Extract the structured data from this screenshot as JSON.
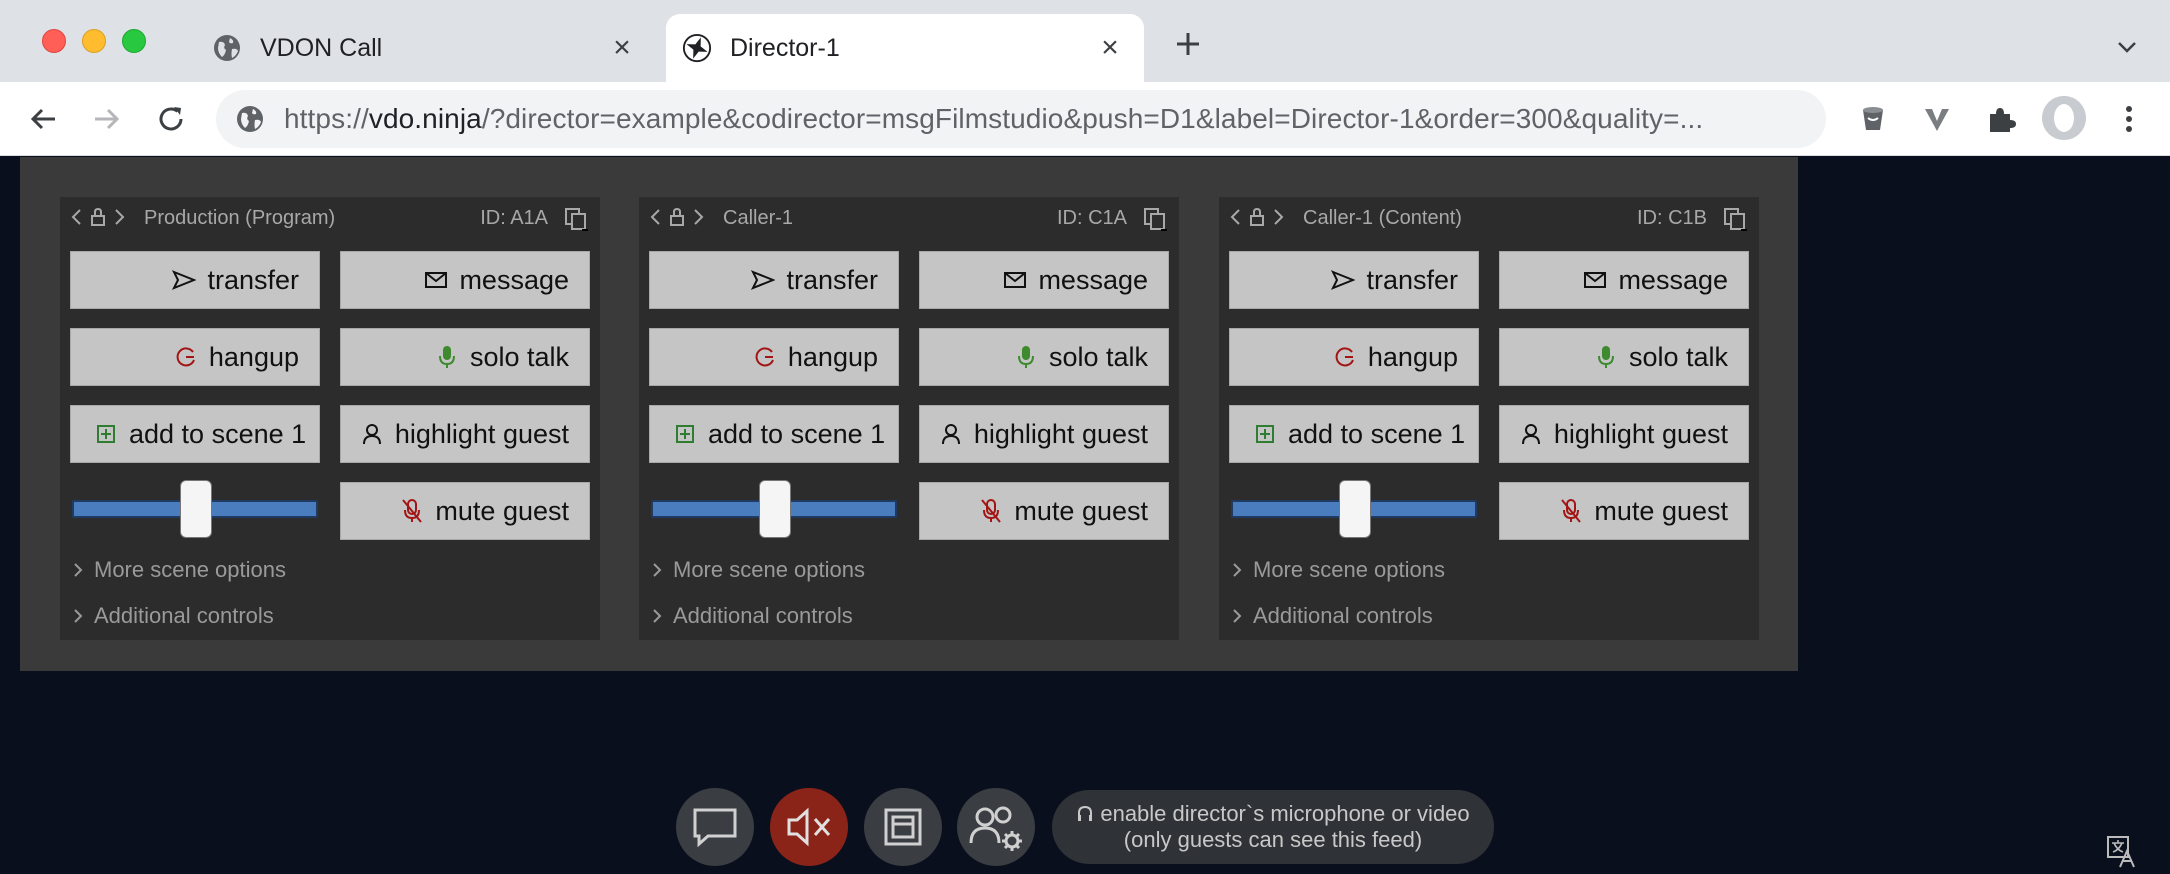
{
  "browser": {
    "tabs": [
      {
        "title": "VDON Call",
        "active": false
      },
      {
        "title": "Director-1",
        "active": true
      }
    ],
    "url_scheme": "https://",
    "url_host": "vdo.ninja",
    "url_rest": "/?director=example&codirector=msgFilmstudio&push=D1&label=Director-1&order=300&quality=..."
  },
  "guests": [
    {
      "label": "Production (Program)",
      "id": "ID: A1A",
      "volume": 0.5
    },
    {
      "label": "Caller-1",
      "id": "ID: C1A",
      "volume": 0.5
    },
    {
      "label": "Caller-1 (Content)",
      "id": "ID: C1B",
      "volume": 0.5
    }
  ],
  "controls": {
    "transfer": "transfer",
    "message": "message",
    "hangup": "hangup",
    "solo_talk": "solo talk",
    "add_to_scene": "add to scene 1",
    "highlight_guest": "highlight guest",
    "mute_guest": "mute guest",
    "more_scene_options": "More scene options",
    "additional_controls": "Additional controls"
  },
  "bottom_bar": {
    "mic_line1": "enable director`s microphone or video",
    "mic_line2": "(only guests can see this feed)"
  },
  "colors": {
    "content_bg": "#0a0f1e",
    "panel_bg": "#3a3a3a",
    "card_bg": "#2c2c2c",
    "button_bg": "#c5c5c5",
    "slider_track": "#4a7dbd",
    "mute_button": "#8b2418"
  },
  "icons": {
    "transfer": "send-icon",
    "message": "envelope-icon",
    "hangup": "hangup-icon",
    "solo_talk": "microphone-icon",
    "add_to_scene": "plus-square-icon",
    "highlight_guest": "person-icon",
    "mute_guest": "mic-off-icon"
  }
}
